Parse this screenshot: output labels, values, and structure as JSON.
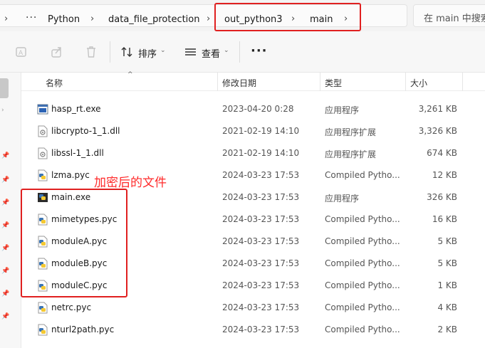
{
  "address_bar": {
    "overflow_label": "···",
    "segments": [
      "Python",
      "data_file_protection",
      "out_python3",
      "main"
    ],
    "search_placeholder": "在 main 中搜索"
  },
  "toolbar": {
    "sort_label": "排序",
    "view_label": "查看",
    "more_label": "···"
  },
  "columns": {
    "name": "名称",
    "date": "修改日期",
    "type": "类型",
    "size": "大小"
  },
  "files": [
    {
      "name": "hasp_rt.exe",
      "date": "2023-04-20 0:28",
      "type": "应用程序",
      "size": "3,261 KB",
      "icon": "exe-window-icon"
    },
    {
      "name": "libcrypto-1_1.dll",
      "date": "2021-02-19 14:10",
      "type": "应用程序扩展",
      "size": "3,326 KB",
      "icon": "dll-file-icon"
    },
    {
      "name": "libssl-1_1.dll",
      "date": "2021-02-19 14:10",
      "type": "应用程序扩展",
      "size": "674 KB",
      "icon": "dll-file-icon"
    },
    {
      "name": "lzma.pyc",
      "date": "2024-03-23 17:53",
      "type": "Compiled Pytho...",
      "size": "12 KB",
      "icon": "python-file-icon"
    },
    {
      "name": "main.exe",
      "date": "2024-03-23 17:53",
      "type": "应用程序",
      "size": "326 KB",
      "icon": "python-exe-icon"
    },
    {
      "name": "mimetypes.pyc",
      "date": "2024-03-23 17:53",
      "type": "Compiled Pytho...",
      "size": "16 KB",
      "icon": "python-file-icon"
    },
    {
      "name": "moduleA.pyc",
      "date": "2024-03-23 17:53",
      "type": "Compiled Pytho...",
      "size": "5 KB",
      "icon": "python-file-icon"
    },
    {
      "name": "moduleB.pyc",
      "date": "2024-03-23 17:53",
      "type": "Compiled Pytho...",
      "size": "5 KB",
      "icon": "python-file-icon"
    },
    {
      "name": "moduleC.pyc",
      "date": "2024-03-23 17:53",
      "type": "Compiled Pytho...",
      "size": "1 KB",
      "icon": "python-file-icon"
    },
    {
      "name": "netrc.pyc",
      "date": "2024-03-23 17:53",
      "type": "Compiled Pytho...",
      "size": "4 KB",
      "icon": "python-file-icon"
    },
    {
      "name": "nturl2path.pyc",
      "date": "2024-03-23 17:53",
      "type": "Compiled Pytho...",
      "size": "2 KB",
      "icon": "python-file-icon"
    }
  ],
  "annotation": {
    "text": "加密后的文件",
    "color": "#ff2a2a"
  },
  "colors": {
    "highlight_box": "#e02020",
    "python_blue": "#3a74b4",
    "python_yellow": "#f5c932"
  }
}
